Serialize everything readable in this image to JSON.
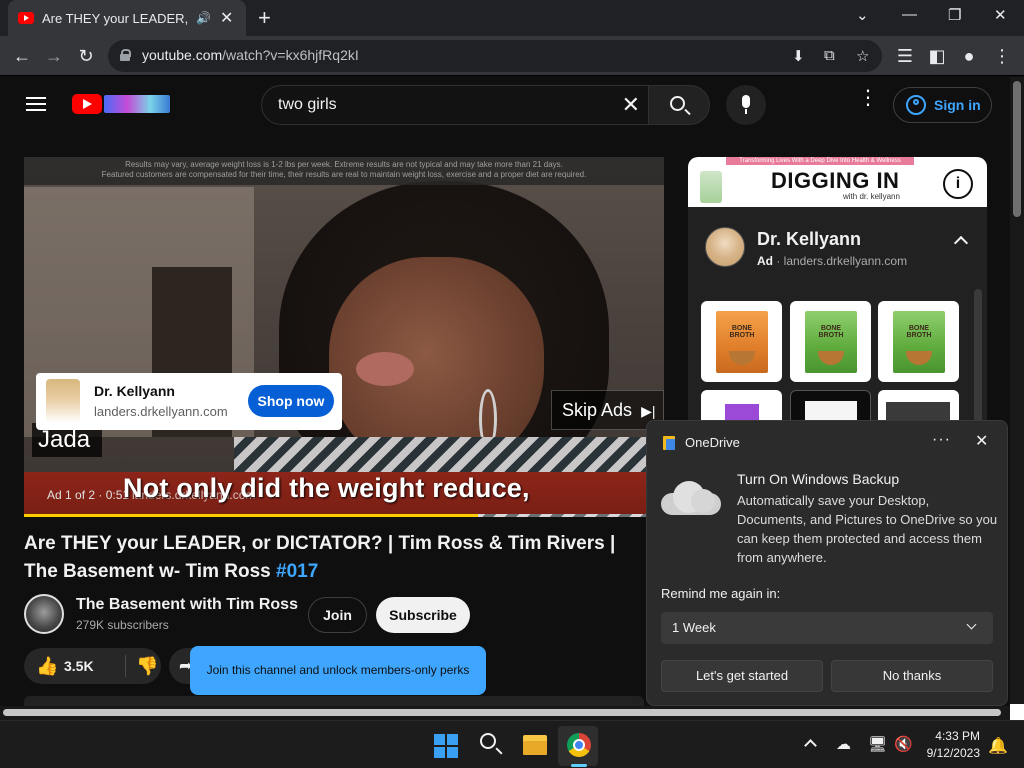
{
  "browser": {
    "tab_title": "Are THEY your LEADER, or DI",
    "url_host": "youtube.com",
    "url_path": "/watch?v=kx6hjfRq2kI"
  },
  "header": {
    "search_value": "two girls",
    "signin_label": "Sign in"
  },
  "player": {
    "top_note_1": "Results may vary, average weight loss is 1-2 lbs per week. Extreme results are not typical and may take more than 21 days.",
    "top_note_2": "Featured customers are compensated for their time, their results are real to maintain weight loss, exercise and a proper diet are required.",
    "speaker_name": "Jada",
    "caption": "Not only did the weight reduce,",
    "ad_info": "Ad 1 of 2 · 0:51",
    "ad_domain": "landers.drkellyann.com",
    "progress": 0.71,
    "ad_card": {
      "title": "Dr. Kellyann",
      "domain": "landers.drkellyann.com",
      "cta": "Shop now"
    },
    "skip_label": "Skip Ads"
  },
  "video": {
    "title": "Are THEY your LEADER, or DICTATOR? | Tim Ross & Tim Rivers | The Basement w- Tim Ross",
    "hashtag": "#017",
    "channel_name": "The Basement with Tim Ross",
    "subscribers": "279K subscribers",
    "join_label": "Join",
    "subscribe_label": "Subscribe",
    "likes": "3.5K",
    "tooltip": "Join this channel and unlock members-only perks"
  },
  "sidebar_ad": {
    "banner_ribbon": "Transforming Lives With a Deep Dive Into Health & Wellness",
    "banner_title": "DIGGING IN",
    "banner_with": "with dr. kellyann",
    "advertiser": "Dr. Kellyann",
    "ad_label": "Ad",
    "domain": "landers.drkellyann.com",
    "products": [
      {
        "label": "BONE BROTH",
        "color": "orange"
      },
      {
        "label": "BONE BROTH",
        "color": "green"
      },
      {
        "label": "BONE BROTH",
        "color": "green"
      }
    ]
  },
  "onedrive": {
    "app_name": "OneDrive",
    "title": "Turn On Windows Backup",
    "body": "Automatically save your Desktop, Documents, and Pictures to OneDrive so you can keep them protected and access them from anywhere.",
    "remind_label": "Remind me again in:",
    "remind_value": "1 Week",
    "primary_button": "Let's get started",
    "secondary_button": "No thanks"
  },
  "taskbar": {
    "time": "4:33 PM",
    "date": "9/12/2023"
  }
}
